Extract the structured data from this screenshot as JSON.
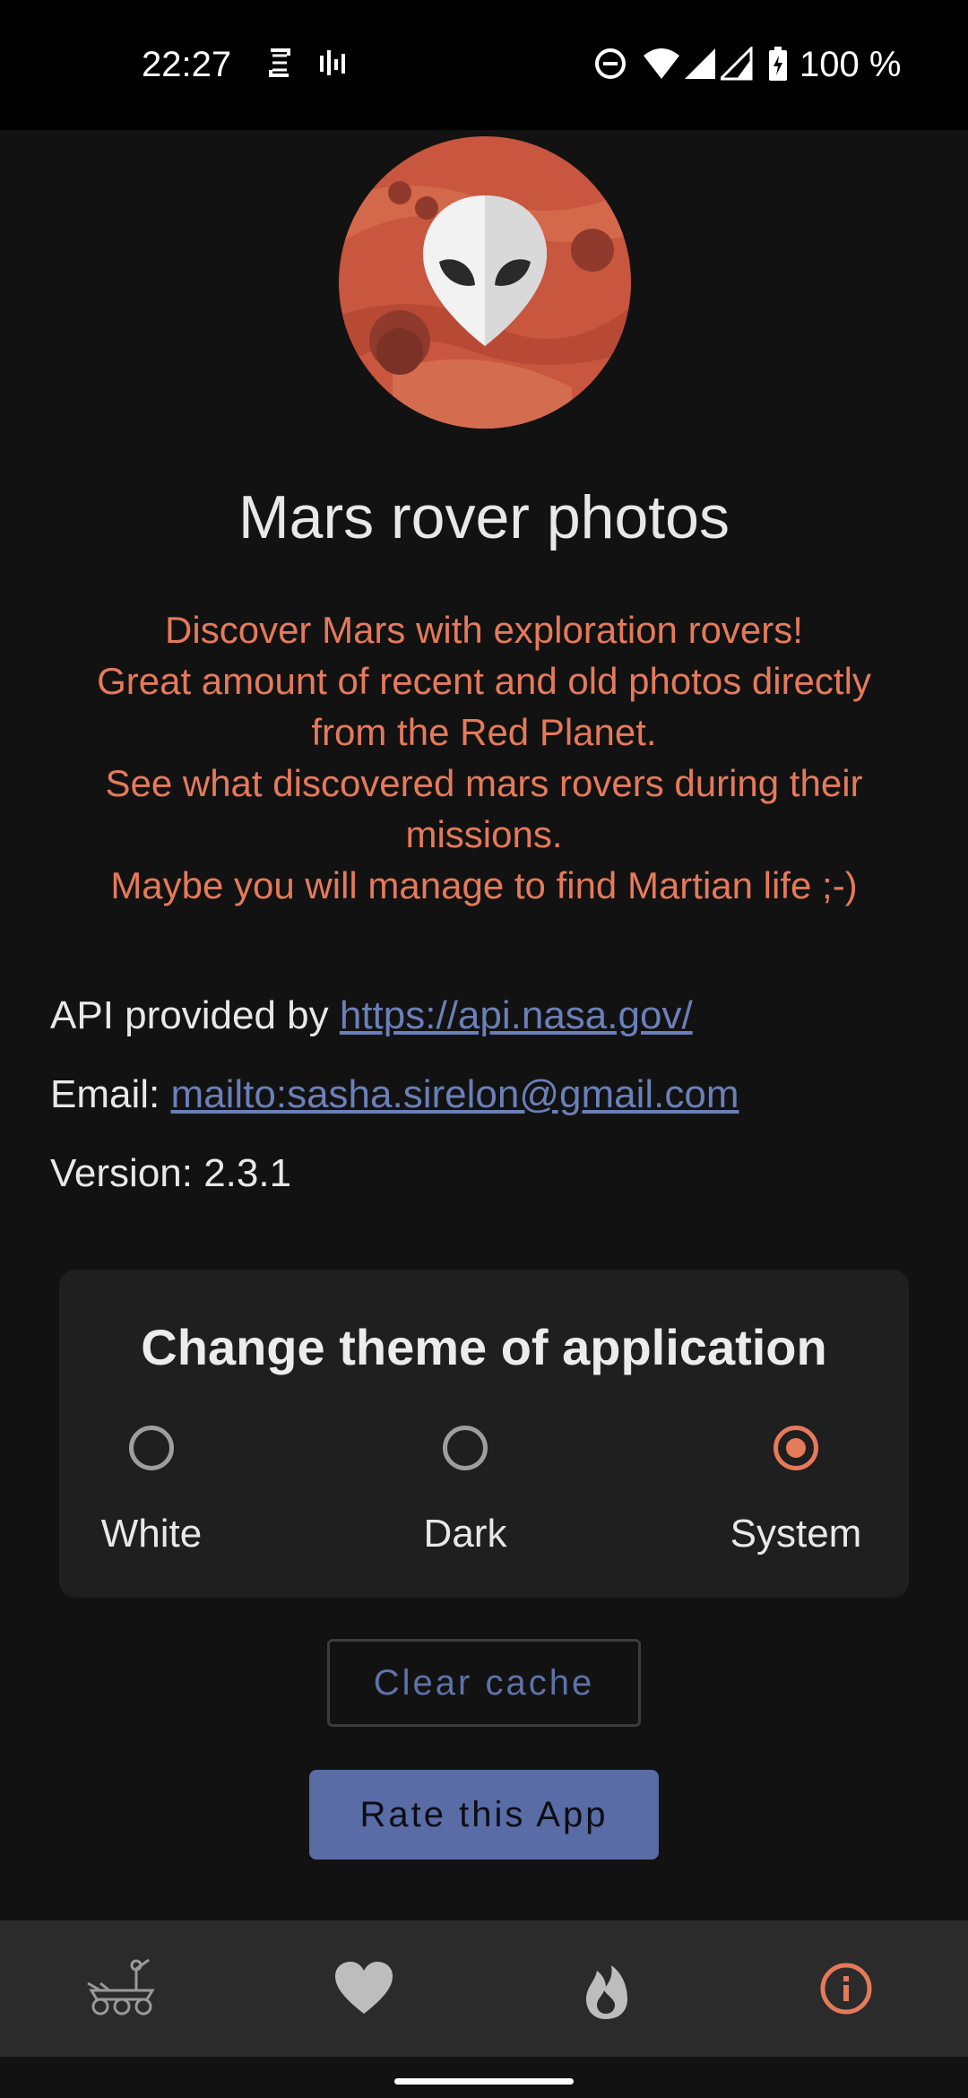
{
  "status_bar": {
    "time": "22:27",
    "battery_text": "100 %"
  },
  "app": {
    "title": "Mars rover photos",
    "description_lines": [
      "Discover Mars with exploration rovers!",
      "Great amount of recent and old photos directly",
      "from the Red Planet.",
      "See what discovered mars rovers during their",
      "missions.",
      "Maybe you will manage to find Martian life ;-)"
    ]
  },
  "info": {
    "api_prefix": "API provided by ",
    "api_link": "https://api.nasa.gov/",
    "email_prefix": "Email: ",
    "email_link": "mailto:sasha.sirelon@gmail.com",
    "version": "Version: 2.3.1"
  },
  "theme": {
    "title": "Change theme of application",
    "options": [
      {
        "label": "White",
        "selected": false
      },
      {
        "label": "Dark",
        "selected": false
      },
      {
        "label": "System",
        "selected": true
      }
    ]
  },
  "buttons": {
    "clear_cache": "Clear cache",
    "rate_app": "Rate this App"
  },
  "bottom_nav": {
    "items": [
      {
        "icon": "rover-icon",
        "active": false
      },
      {
        "icon": "heart-icon",
        "active": false
      },
      {
        "icon": "fire-icon",
        "active": false
      },
      {
        "icon": "info-icon",
        "active": true
      }
    ]
  },
  "colors": {
    "accent": "#e57a5a",
    "link": "#6b7fb8",
    "button": "#5a6ca6",
    "background": "#121212"
  }
}
